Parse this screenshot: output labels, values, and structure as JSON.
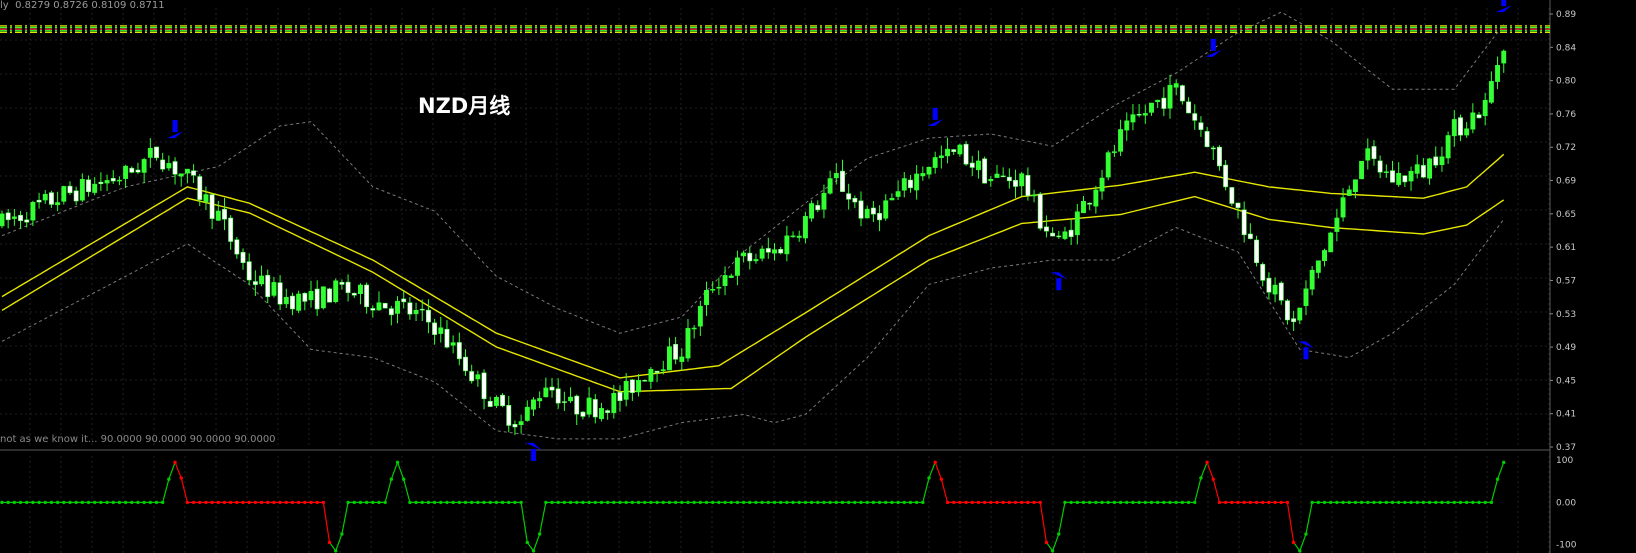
{
  "header": {
    "prefix": "ly",
    "ohlc": "0.8279 0.8726 0.8109 0.8711"
  },
  "title": "NZD月线",
  "subheader": "not as we know it...  90.0000 90.0000 90.0000 90.0000",
  "colors": {
    "bull": "#33ff33",
    "bear_fill": "#ffffff",
    "bear_outline": "#33ff33",
    "ema": "#e6e600",
    "band": "#7a7a7a",
    "grid": "#202020",
    "arrow": "#0000ff",
    "osc_up": "#00cc00",
    "osc_down": "#ff0000"
  },
  "axis_labels": {
    "main": [
      "0.89",
      "0.84",
      "0.80",
      "0.76",
      "0.72",
      "0.69",
      "0.65",
      "0.61",
      "0.57",
      "0.53",
      "0.49",
      "0.45",
      "0.41",
      "0.37"
    ],
    "osc": [
      "100",
      "0.00",
      "-100"
    ]
  },
  "chart_data": [
    {
      "type": "candlestick",
      "title": "NZD月线",
      "ylim": [
        0.36,
        0.9
      ],
      "price_anchors": [
        [
          0,
          0.635
        ],
        [
          10,
          0.67
        ],
        [
          20,
          0.695
        ],
        [
          25,
          0.722
        ],
        [
          30,
          0.69
        ],
        [
          35,
          0.645
        ],
        [
          40,
          0.57
        ],
        [
          45,
          0.545
        ],
        [
          50,
          0.54
        ],
        [
          55,
          0.555
        ],
        [
          60,
          0.54
        ],
        [
          65,
          0.53
        ],
        [
          70,
          0.51
        ],
        [
          75,
          0.46
        ],
        [
          80,
          0.41
        ],
        [
          84,
          0.39
        ],
        [
          88,
          0.44
        ],
        [
          92,
          0.41
        ],
        [
          96,
          0.41
        ],
        [
          100,
          0.42
        ],
        [
          105,
          0.46
        ],
        [
          110,
          0.48
        ],
        [
          115,
          0.56
        ],
        [
          120,
          0.59
        ],
        [
          125,
          0.6
        ],
        [
          130,
          0.64
        ],
        [
          135,
          0.69
        ],
        [
          140,
          0.64
        ],
        [
          145,
          0.67
        ],
        [
          150,
          0.71
        ],
        [
          155,
          0.722
        ],
        [
          160,
          0.69
        ],
        [
          165,
          0.69
        ],
        [
          168,
          0.64
        ],
        [
          171,
          0.61
        ],
        [
          173,
          0.632
        ],
        [
          176,
          0.67
        ],
        [
          181,
          0.74
        ],
        [
          186,
          0.78
        ],
        [
          190,
          0.8
        ],
        [
          195,
          0.74
        ],
        [
          200,
          0.65
        ],
        [
          205,
          0.56
        ],
        [
          209,
          0.51
        ],
        [
          212,
          0.57
        ],
        [
          216,
          0.64
        ],
        [
          220,
          0.72
        ],
        [
          225,
          0.69
        ],
        [
          230,
          0.7
        ],
        [
          235,
          0.75
        ],
        [
          240,
          0.78
        ],
        [
          243,
          0.86
        ]
      ],
      "ema_fast_anchors": [
        [
          0,
          0.545
        ],
        [
          30,
          0.68
        ],
        [
          40,
          0.66
        ],
        [
          60,
          0.59
        ],
        [
          80,
          0.5
        ],
        [
          100,
          0.445
        ],
        [
          116,
          0.46
        ],
        [
          130,
          0.525
        ],
        [
          150,
          0.62
        ],
        [
          165,
          0.668
        ],
        [
          181,
          0.682
        ],
        [
          193,
          0.698
        ],
        [
          205,
          0.68
        ],
        [
          215,
          0.672
        ],
        [
          230,
          0.666
        ],
        [
          237,
          0.68
        ],
        [
          243,
          0.72
        ]
      ],
      "ema_slow_anchors": [
        [
          0,
          0.528
        ],
        [
          30,
          0.666
        ],
        [
          40,
          0.648
        ],
        [
          60,
          0.575
        ],
        [
          80,
          0.483
        ],
        [
          100,
          0.428
        ],
        [
          118,
          0.432
        ],
        [
          130,
          0.495
        ],
        [
          150,
          0.59
        ],
        [
          165,
          0.635
        ],
        [
          181,
          0.646
        ],
        [
          193,
          0.668
        ],
        [
          205,
          0.64
        ],
        [
          215,
          0.63
        ],
        [
          230,
          0.622
        ],
        [
          237,
          0.633
        ],
        [
          243,
          0.664
        ]
      ],
      "band_upper_anchors": [
        [
          0,
          0.62
        ],
        [
          20,
          0.68
        ],
        [
          35,
          0.705
        ],
        [
          45,
          0.755
        ],
        [
          50,
          0.76
        ],
        [
          60,
          0.68
        ],
        [
          70,
          0.65
        ],
        [
          80,
          0.57
        ],
        [
          90,
          0.53
        ],
        [
          100,
          0.5
        ],
        [
          110,
          0.52
        ],
        [
          120,
          0.6
        ],
        [
          130,
          0.66
        ],
        [
          140,
          0.715
        ],
        [
          150,
          0.74
        ],
        [
          160,
          0.745
        ],
        [
          170,
          0.73
        ],
        [
          180,
          0.78
        ],
        [
          190,
          0.82
        ],
        [
          200,
          0.87
        ],
        [
          207,
          0.895
        ],
        [
          215,
          0.86
        ],
        [
          225,
          0.8
        ],
        [
          235,
          0.8
        ],
        [
          243,
          0.88
        ]
      ],
      "band_lower_anchors": [
        [
          0,
          0.49
        ],
        [
          20,
          0.57
        ],
        [
          30,
          0.61
        ],
        [
          40,
          0.56
        ],
        [
          50,
          0.48
        ],
        [
          60,
          0.47
        ],
        [
          70,
          0.44
        ],
        [
          80,
          0.38
        ],
        [
          90,
          0.37
        ],
        [
          100,
          0.37
        ],
        [
          110,
          0.39
        ],
        [
          120,
          0.4
        ],
        [
          125,
          0.39
        ],
        [
          130,
          0.4
        ],
        [
          140,
          0.47
        ],
        [
          150,
          0.56
        ],
        [
          160,
          0.58
        ],
        [
          170,
          0.59
        ],
        [
          180,
          0.59
        ],
        [
          190,
          0.63
        ],
        [
          200,
          0.6
        ],
        [
          210,
          0.48
        ],
        [
          218,
          0.47
        ],
        [
          225,
          0.5
        ],
        [
          235,
          0.56
        ],
        [
          243,
          0.64
        ]
      ],
      "down_arrows": [
        {
          "bar": 28,
          "price": 0.74
        },
        {
          "bar": 151,
          "price": 0.755
        },
        {
          "bar": 196,
          "price": 0.84
        },
        {
          "bar": 243,
          "price": 0.895
        }
      ],
      "up_arrows": [
        {
          "bar": 86,
          "price": 0.365
        },
        {
          "bar": 171,
          "price": 0.575
        },
        {
          "bar": 211,
          "price": 0.49
        }
      ],
      "dashed_levels": [
        {
          "price": 0.878,
          "color": "#e6e600"
        },
        {
          "price": 0.876,
          "color": "#33ff33"
        },
        {
          "price": 0.874,
          "color": "#ff3333"
        },
        {
          "price": 0.872,
          "color": "#33ff33"
        },
        {
          "price": 0.87,
          "color": "#e6e600"
        }
      ]
    },
    {
      "type": "line",
      "title": "not as we know it...",
      "ylim": [
        -120,
        110
      ],
      "base_level": 0,
      "points": [
        [
          0,
          0
        ],
        [
          26,
          0
        ],
        [
          27,
          55
        ],
        [
          28,
          95
        ],
        [
          29,
          58
        ],
        [
          30,
          0
        ],
        [
          52,
          0
        ],
        [
          53,
          -95
        ],
        [
          54,
          -115
        ],
        [
          55,
          -75
        ],
        [
          56,
          0
        ],
        [
          62,
          0
        ],
        [
          63,
          55
        ],
        [
          64,
          95
        ],
        [
          65,
          55
        ],
        [
          66,
          0
        ],
        [
          84,
          0
        ],
        [
          85,
          -95
        ],
        [
          86,
          -115
        ],
        [
          87,
          -75
        ],
        [
          88,
          0
        ],
        [
          149,
          0
        ],
        [
          150,
          58
        ],
        [
          151,
          95
        ],
        [
          152,
          55
        ],
        [
          153,
          0
        ],
        [
          168,
          0
        ],
        [
          169,
          -95
        ],
        [
          170,
          -115
        ],
        [
          171,
          -75
        ],
        [
          172,
          0
        ],
        [
          193,
          0
        ],
        [
          194,
          58
        ],
        [
          195,
          95
        ],
        [
          196,
          55
        ],
        [
          197,
          0
        ],
        [
          208,
          0
        ],
        [
          209,
          -95
        ],
        [
          210,
          -115
        ],
        [
          211,
          -75
        ],
        [
          212,
          0
        ],
        [
          241,
          0
        ],
        [
          242,
          55
        ],
        [
          243,
          95
        ]
      ],
      "down_segments": [
        [
          28,
          53
        ],
        [
          151,
          169
        ],
        [
          195,
          209
        ]
      ]
    }
  ]
}
